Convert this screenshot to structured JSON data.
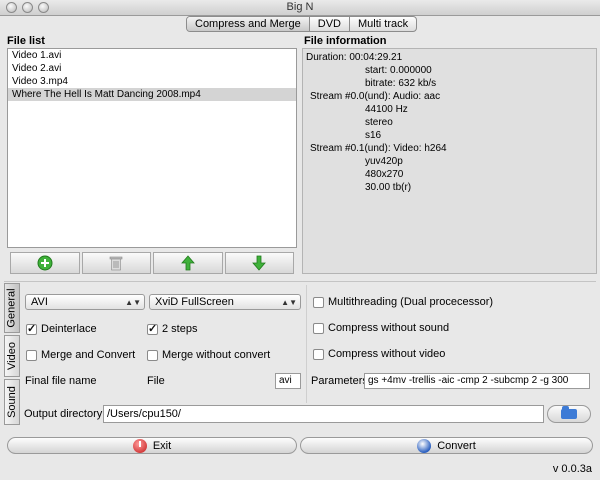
{
  "window": {
    "title": "Big N"
  },
  "tabs": [
    "Compress and Merge",
    "DVD",
    "Multi track"
  ],
  "file_list": {
    "label": "File list",
    "items": [
      "Video 1.avi",
      "Video 2.avi",
      "Video 3.mp4",
      "Where The Hell Is Matt Dancing 2008.mp4"
    ],
    "selected_index": 3
  },
  "file_info": {
    "label": "File information",
    "lines": [
      "Duration: 00:04:29.21",
      "start: 0.000000",
      "bitrate: 632 kb/s",
      "Stream #0.0(und): Audio: aac",
      "44100 Hz",
      "stereo",
      "s16",
      "Stream #0.1(und): Video: h264",
      "yuv420p",
      "480x270",
      "30.00 tb(r)"
    ]
  },
  "side_tabs": [
    "General",
    "Video",
    "Sound"
  ],
  "general": {
    "container_value": "AVI",
    "preset_value": "XviD FullScreen",
    "deinterlace_label": "Deinterlace",
    "deinterlace_checked": true,
    "two_steps_label": "2 steps",
    "two_steps_checked": true,
    "merge_convert_label": "Merge and Convert",
    "merge_convert_checked": false,
    "merge_no_convert_label": "Merge without convert",
    "merge_no_convert_checked": false,
    "final_name_label": "Final file name",
    "final_name_value": "File",
    "extension_value": "avi"
  },
  "options": {
    "multithreading_label": "Multithreading (Dual procecessor)",
    "no_sound_label": "Compress without sound",
    "no_video_label": "Compress without video",
    "parameters_label": "Parameters",
    "parameters_value": "gs +4mv -trellis -aic -cmp 2 -subcmp 2 -g 300"
  },
  "output": {
    "label": "Output directory",
    "value": "/Users/cpu150/"
  },
  "buttons": {
    "exit": "Exit",
    "convert": "Convert"
  },
  "version": "v 0.0.3a",
  "icons": {
    "add": "plus-circle-icon",
    "remove": "trash-icon",
    "up": "green-arrow-up-icon",
    "down": "green-arrow-down-icon",
    "browse": "folder-icon"
  },
  "colors": {
    "accent_green": "#3fb13a",
    "exit_red": "#c21818",
    "convert_blue": "#2a5fc0"
  }
}
